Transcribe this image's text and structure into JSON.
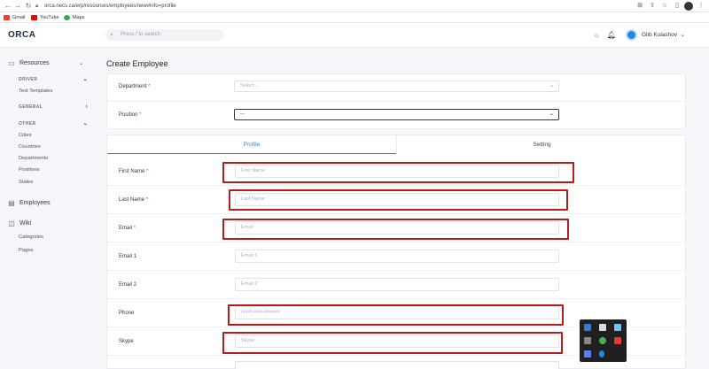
{
  "browser": {
    "url": "orca.necs.ca/erp/resources/employees/new#info=profile",
    "bookmarks": [
      {
        "label": "Gmail",
        "color": "#ea4335"
      },
      {
        "label": "YouTube",
        "color": "#ff0000"
      },
      {
        "label": "Maps",
        "color": "#34a853"
      }
    ]
  },
  "header": {
    "logo": "ORCA",
    "search_placeholder": "Press / to search",
    "user_name": "Glib Kulashov"
  },
  "sidebar": {
    "resources": "Resources",
    "driver": "DRIVER",
    "text_templates": "Text Templates",
    "general": "GENERAL",
    "other": "OTHER",
    "other_items": [
      "Cities",
      "Countries",
      "Departments",
      "Positions",
      "States"
    ],
    "employees": "Employees",
    "wiki": "Wiki",
    "wiki_items": [
      "Categories",
      "Pages"
    ]
  },
  "page": {
    "title": "Create Employee",
    "department_label": "Department",
    "department_placeholder": "Select...",
    "position_label": "Position",
    "position_value": "---",
    "required_mark": "*"
  },
  "tabs": {
    "profile": "Profile",
    "setting": "Setting"
  },
  "form": {
    "fields": [
      {
        "label": "First Name",
        "required": "*",
        "placeholder": "First Name"
      },
      {
        "label": "Last Name",
        "required": "*",
        "placeholder": "Last Name"
      },
      {
        "label": "Email",
        "required": "*",
        "placeholder": "Email"
      },
      {
        "label": "Email 1",
        "required": "",
        "placeholder": "Email 1"
      },
      {
        "label": "Email 2",
        "required": "",
        "placeholder": "Email 2"
      },
      {
        "label": "Phone",
        "required": "",
        "placeholder": "(###)-###-######"
      },
      {
        "label": "Skype",
        "required": "",
        "placeholder": "Skype"
      }
    ]
  },
  "colors": {
    "accent": "#1e88e5",
    "highlight": "#b71c1c",
    "required": "#e53935"
  }
}
